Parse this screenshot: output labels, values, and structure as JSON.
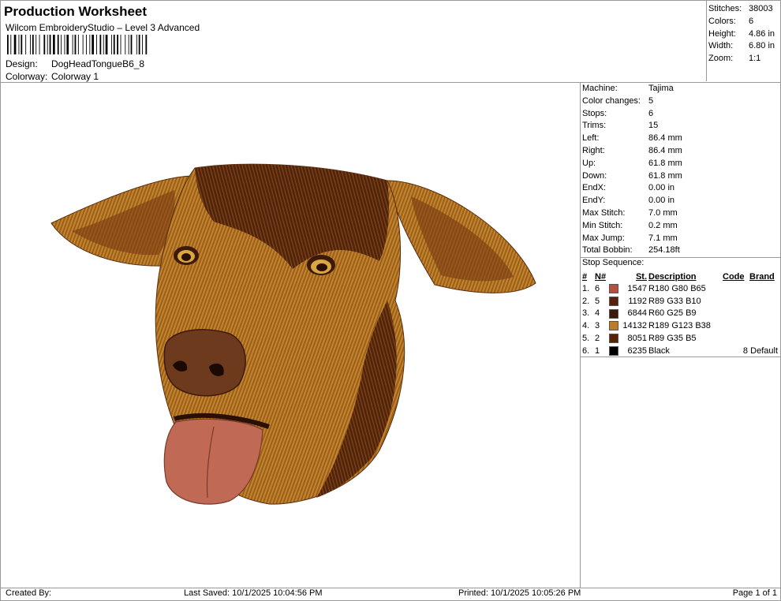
{
  "header": {
    "title": "Production Worksheet",
    "subtitle": "Wilcom EmbroideryStudio – Level 3 Advanced",
    "design_label": "Design:",
    "design_value": "DogHeadTongueB6_8",
    "colorway_label": "Colorway:",
    "colorway_value": "Colorway 1"
  },
  "summary": [
    {
      "label": "Stitches:",
      "value": "38003"
    },
    {
      "label": "Colors:",
      "value": "6"
    },
    {
      "label": "Height:",
      "value": "4.86 in"
    },
    {
      "label": "Width:",
      "value": "6.80 in"
    },
    {
      "label": "Zoom:",
      "value": "1:1"
    }
  ],
  "machine": [
    {
      "label": "Machine:",
      "value": "Tajima"
    },
    {
      "label": "Color changes:",
      "value": "5"
    },
    {
      "label": "Stops:",
      "value": "6"
    },
    {
      "label": "Trims:",
      "value": "15"
    },
    {
      "label": "Left:",
      "value": "86.4 mm"
    },
    {
      "label": "Right:",
      "value": "86.4 mm"
    },
    {
      "label": "Up:",
      "value": "61.8 mm"
    },
    {
      "label": "Down:",
      "value": "61.8 mm"
    },
    {
      "label": "EndX:",
      "value": "0.00 in"
    },
    {
      "label": "EndY:",
      "value": "0.00 in"
    },
    {
      "label": "Max Stitch:",
      "value": "7.0 mm"
    },
    {
      "label": "Min Stitch:",
      "value": "0.2 mm"
    },
    {
      "label": "Max Jump:",
      "value": "7.1 mm"
    },
    {
      "label": "Total Bobbin:",
      "value": "254.18ft"
    }
  ],
  "stop_sequence": {
    "title": "Stop Sequence:",
    "headers": {
      "num": "#",
      "n": "N#",
      "st": "St.",
      "desc": "Description",
      "code": "Code",
      "brand": "Brand"
    },
    "rows": [
      {
        "num": "1.",
        "n": "6",
        "color": "#B4504 1",
        "hex": "#B45041",
        "st": "1547",
        "desc": "R180 G80 B65",
        "code": "",
        "brand": ""
      },
      {
        "num": "2.",
        "n": "5",
        "hex": "#59210A",
        "st": "1192",
        "desc": "R89 G33 B10",
        "code": "",
        "brand": ""
      },
      {
        "num": "3.",
        "n": "4",
        "hex": "#3C1909",
        "st": "6844",
        "desc": "R60 G25 B9",
        "code": "",
        "brand": ""
      },
      {
        "num": "4.",
        "n": "3",
        "hex": "#BD7B26",
        "st": "14132",
        "desc": "R189 G123 B38",
        "code": "",
        "brand": ""
      },
      {
        "num": "5.",
        "n": "2",
        "hex": "#592305",
        "st": "8051",
        "desc": "R89 G35 B5",
        "code": "",
        "brand": ""
      },
      {
        "num": "6.",
        "n": "1",
        "hex": "#000000",
        "st": "6235",
        "desc": "Black",
        "code": "8",
        "brand": "Default"
      }
    ]
  },
  "footer": {
    "created_by": "Created By:",
    "last_saved": "Last Saved: 10/1/2025 10:04:56 PM",
    "printed": "Printed: 10/1/2025 10:05:26 PM",
    "page": "Page 1 of 1"
  },
  "colors": {
    "border": "#9a9a9a",
    "fur_light": "#BD7B26",
    "fur_dark": "#59210A",
    "nose": "#3C1909",
    "tongue": "#B45041"
  }
}
